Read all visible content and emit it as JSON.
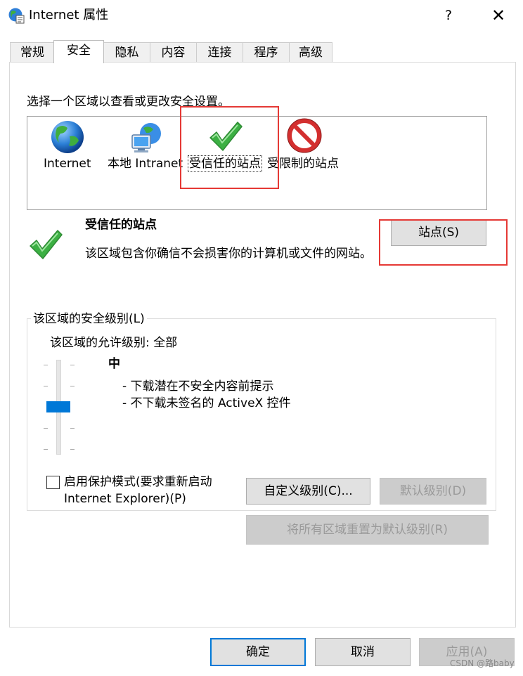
{
  "window": {
    "title": "Internet 属性",
    "help_label": "?",
    "close_label": "✕"
  },
  "tabs": [
    {
      "label": "常规"
    },
    {
      "label": "安全"
    },
    {
      "label": "隐私"
    },
    {
      "label": "内容"
    },
    {
      "label": "连接"
    },
    {
      "label": "程序"
    },
    {
      "label": "高级"
    }
  ],
  "active_tab": "安全",
  "security": {
    "instruction": "选择一个区域以查看或更改安全设置。",
    "zones": [
      {
        "label": "Internet",
        "icon": "globe-icon"
      },
      {
        "label": "本地 Intranet",
        "icon": "intranet-icon"
      },
      {
        "label": "受信任的站点",
        "icon": "checkmark-icon"
      },
      {
        "label": "受限制的站点",
        "icon": "restricted-icon"
      }
    ],
    "selected_zone": "受信任的站点",
    "info": {
      "title": "受信任的站点",
      "description": "该区域包含你确信不会损害你的计算机或文件的网站。",
      "sites_button": "站点(S)"
    },
    "level_group": {
      "legend": "该区域的安全级别(L)",
      "allowed_levels": "该区域的允许级别: 全部",
      "level_name": "中",
      "level_items": [
        "- 下载潜在不安全内容前提示",
        "- 不下载未签名的 ActiveX 控件"
      ],
      "protected_mode_label": "启用保护模式(要求重新启动 Internet Explorer)(P)",
      "protected_mode_checked": false,
      "custom_level_button": "自定义级别(C)...",
      "default_level_button": "默认级别(D)"
    },
    "reset_all_button": "将所有区域重置为默认级别(R)"
  },
  "footer": {
    "ok_button": "确定",
    "cancel_button": "取消",
    "apply_button": "应用(A)"
  },
  "watermark": "CSDN @路baby",
  "colors": {
    "accent": "#0078d7",
    "highlight_box": "#e53935",
    "check_green": "#3cb043",
    "restricted_red": "#d32f2f"
  }
}
